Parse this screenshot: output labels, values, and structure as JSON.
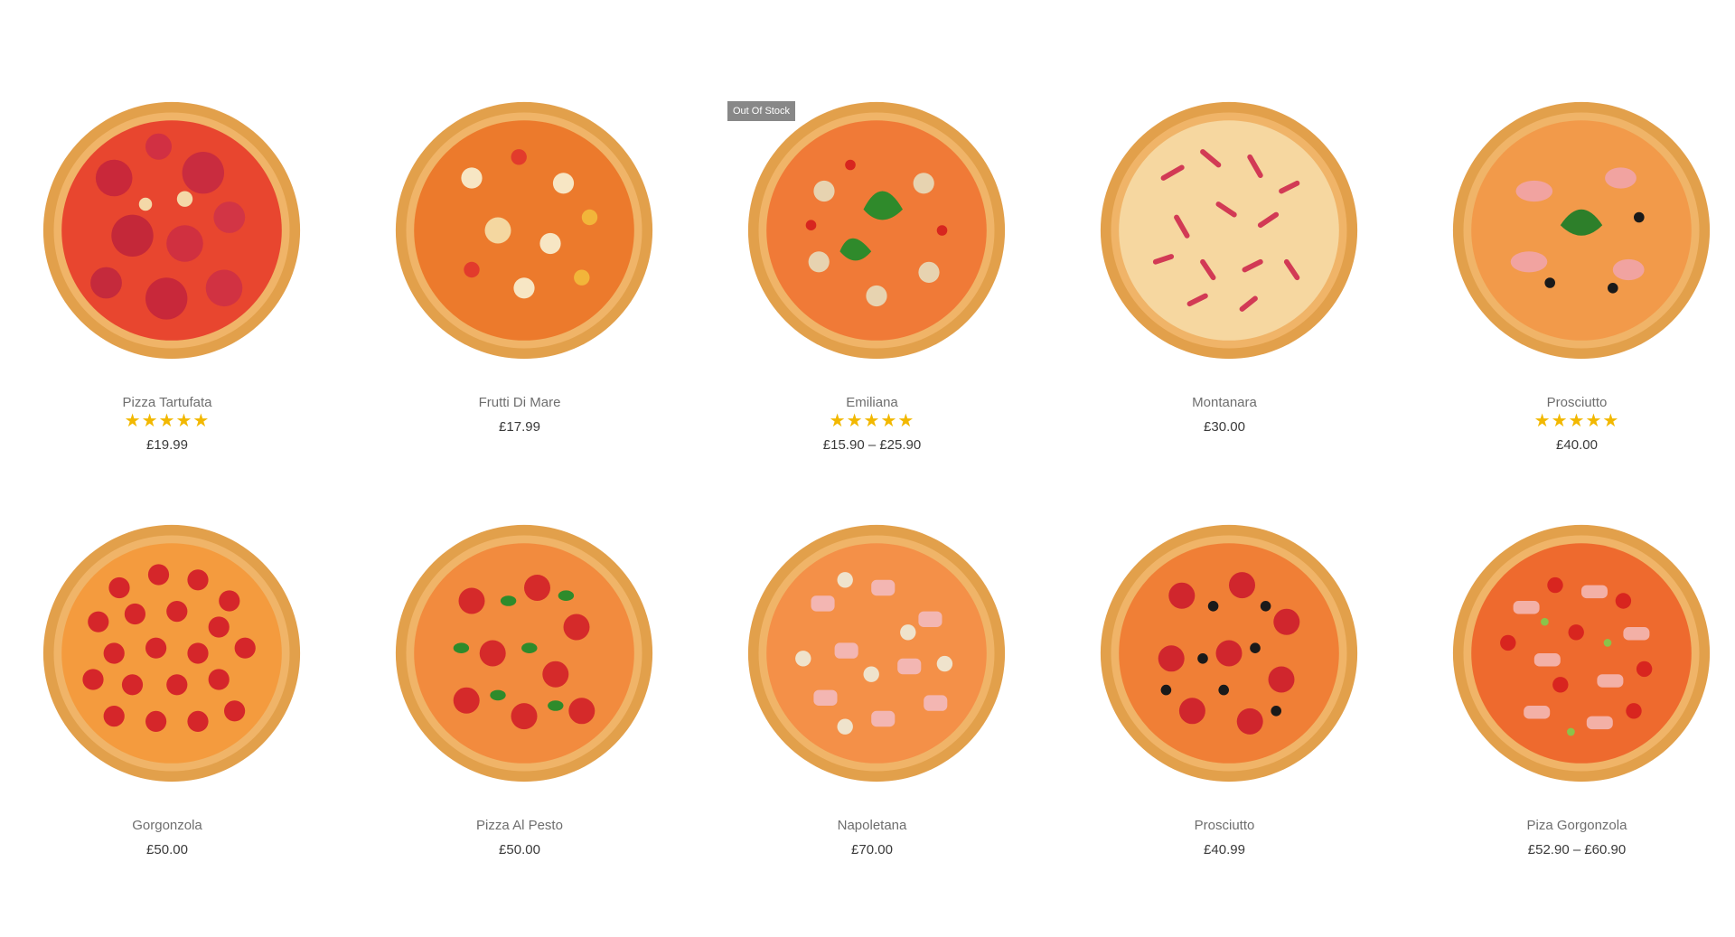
{
  "products": [
    {
      "name": "Pizza Tartufata",
      "rating": 5,
      "price": "£19.99",
      "topping": "salami-heavy",
      "out_of_stock": false
    },
    {
      "name": "Frutti Di Mare",
      "rating": 0,
      "price": "£17.99",
      "topping": "seafood",
      "out_of_stock": false
    },
    {
      "name": "Emiliana",
      "rating": 5,
      "price": "£15.90 – £25.90",
      "topping": "mushroom-basil",
      "out_of_stock": true
    },
    {
      "name": "Montanara",
      "rating": 0,
      "price": "£30.00",
      "topping": "ham-strips",
      "out_of_stock": false
    },
    {
      "name": "Prosciutto",
      "rating": 5,
      "price": "£40.00",
      "topping": "prosciutto-olive",
      "out_of_stock": false
    },
    {
      "name": "Gorgonzola",
      "rating": 0,
      "price": "£50.00",
      "topping": "pepperoni",
      "out_of_stock": false
    },
    {
      "name": "Pizza Al Pesto",
      "rating": 0,
      "price": "£50.00",
      "topping": "pepperoni-basil",
      "out_of_stock": false
    },
    {
      "name": "Napoletana",
      "rating": 0,
      "price": "£70.00",
      "topping": "ham-mushroom",
      "out_of_stock": false
    },
    {
      "name": "Prosciutto",
      "rating": 0,
      "price": "£40.99",
      "topping": "salami-olive",
      "out_of_stock": false
    },
    {
      "name": "Piza Gorgonzola",
      "rating": 0,
      "price": "£52.90 – £60.90",
      "topping": "ham-tomato-chili",
      "out_of_stock": false
    }
  ],
  "badge_label": "Out Of Stock",
  "stars": "★★★★★",
  "colors": {
    "crust": "#e8a54b",
    "sauce": "#e0522a",
    "cheese": "#f3b76a",
    "star": "#f2b800",
    "badge": "#888888"
  }
}
